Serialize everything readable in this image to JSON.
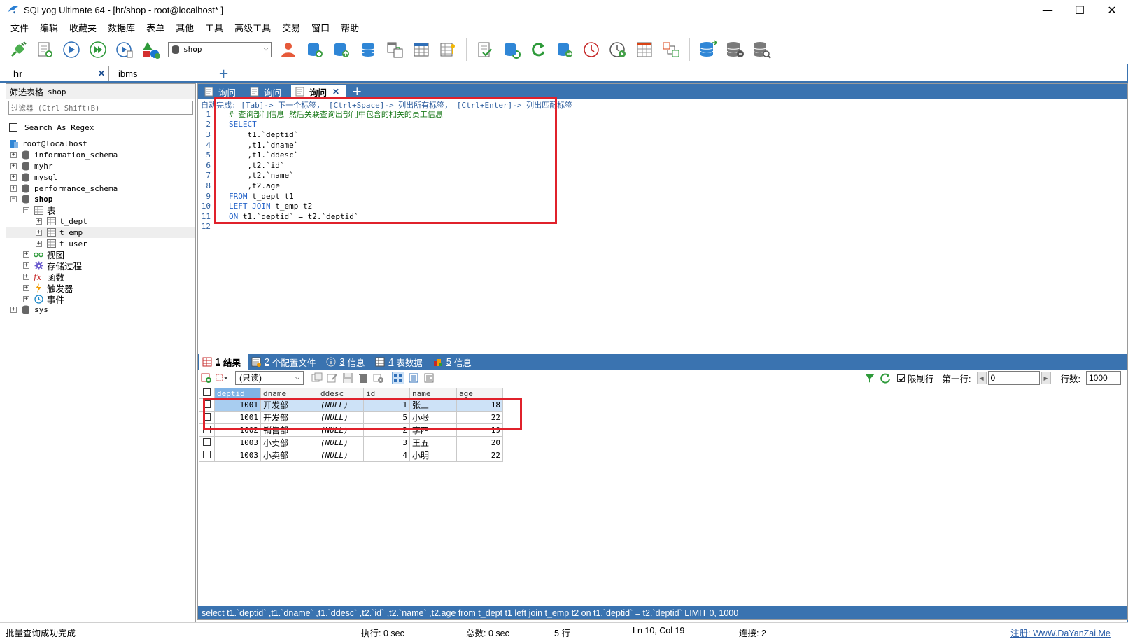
{
  "window": {
    "title": "SQLyog Ultimate 64 - [hr/shop - root@localhost* ]",
    "minimize": "—",
    "maximize": "☐",
    "close": "✕"
  },
  "menu": [
    "文件",
    "编辑",
    "收藏夹",
    "数据库",
    "表单",
    "其他",
    "工具",
    "高级工具",
    "交易",
    "窗口",
    "帮助"
  ],
  "toolbar": {
    "database_select": "shop"
  },
  "connection_tabs": [
    {
      "label": "hr",
      "close": "✕",
      "active": true
    },
    {
      "label": "ibms",
      "active": false
    }
  ],
  "connection_tab_add": "+",
  "left_panel": {
    "filter_label": "筛选表格",
    "filter_db": "shop",
    "filter_placeholder": "过滤器 (Ctrl+Shift+B)",
    "regex_label": "Search As Regex",
    "tree": {
      "root": "root@localhost",
      "dbs": [
        "information_schema",
        "myhr",
        "mysql",
        "performance_schema"
      ],
      "shop": "shop",
      "tables_folder": "表",
      "tables": [
        "t_dept",
        "t_emp",
        "t_user"
      ],
      "folders": [
        "视图",
        "存储过程",
        "函数",
        "触发器",
        "事件"
      ],
      "sys": "sys"
    }
  },
  "query_tabs": [
    {
      "label": "询问"
    },
    {
      "label": "询问"
    },
    {
      "label": "询问",
      "close": "✕",
      "active": true
    }
  ],
  "query_tab_add": "+",
  "editor": {
    "hint": "自动完成: [Tab]-> 下一个标签， [Ctrl+Space]-> 列出所有标签， [Ctrl+Enter]-> 列出匹配标签",
    "lines": [
      {
        "n": "1",
        "text": "# 查询部门信息 然后关联查询出部门中包含的相关的员工信息"
      },
      {
        "n": "2",
        "text": "SELECT"
      },
      {
        "n": "3",
        "text": "    t1.`deptid`"
      },
      {
        "n": "4",
        "text": "    ,t1.`dname`"
      },
      {
        "n": "5",
        "text": "    ,t1.`ddesc`"
      },
      {
        "n": "6",
        "text": "    ,t2.`id`"
      },
      {
        "n": "7",
        "text": "    ,t2.`name`"
      },
      {
        "n": "8",
        "text": "    ,t2.age"
      },
      {
        "n": "9",
        "text": "FROM t_dept t1"
      },
      {
        "n": "10",
        "text": "LEFT JOIN t_emp t2"
      },
      {
        "n": "11",
        "text": "ON t1.`deptid` = t2.`deptid`"
      },
      {
        "n": "12",
        "text": ""
      }
    ]
  },
  "result_tabs": [
    {
      "num": "1",
      "label": "结果",
      "active": true
    },
    {
      "num": "2",
      "label": "个配置文件"
    },
    {
      "num": "3",
      "label": "信息"
    },
    {
      "num": "4",
      "label": "表数据"
    },
    {
      "num": "5",
      "label": "信息"
    }
  ],
  "result_toolbar": {
    "mode": "(只读)",
    "limit_label": "限制行",
    "first_row_label": "第一行:",
    "first_row_value": "0",
    "rows_label": "行数:",
    "rows_value": "1000"
  },
  "grid": {
    "columns": [
      "deptid",
      "dname",
      "ddesc",
      "id",
      "name",
      "age"
    ],
    "rows": [
      [
        "1001",
        "开发部",
        "(NULL)",
        "1",
        "张三",
        "18"
      ],
      [
        "1001",
        "开发部",
        "(NULL)",
        "5",
        "小张",
        "22"
      ],
      [
        "1002",
        "销售部",
        "(NULL)",
        "2",
        "李四",
        "19"
      ],
      [
        "1003",
        "小卖部",
        "(NULL)",
        "3",
        "王五",
        "20"
      ],
      [
        "1003",
        "小卖部",
        "(NULL)",
        "4",
        "小明",
        "22"
      ]
    ]
  },
  "sql_status": "select t1.`deptid` ,t1.`dname` ,t1.`ddesc` ,t2.`id` ,t2.`name` ,t2.age from t_dept t1 left join t_emp t2 on t1.`deptid` = t2.`deptid` LIMIT 0, 1000",
  "statusbar": {
    "message": "批量查询成功完成",
    "exec": "执行: 0 sec",
    "total": "总数: 0 sec",
    "rows": "5 行",
    "position": "Ln 10, Col 19",
    "connections": "连接: 2",
    "register": "注册:  WwW.DaYanZai.Me"
  }
}
